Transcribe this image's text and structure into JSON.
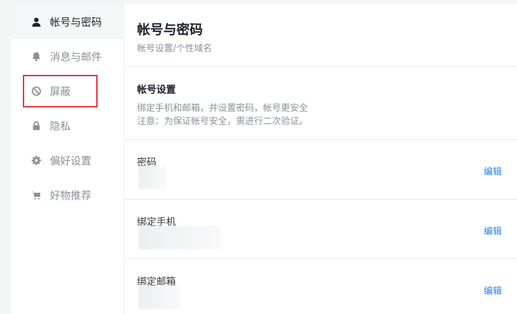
{
  "sidebar": {
    "items": [
      {
        "label": "帐号与密码",
        "icon": "user-icon",
        "active": true
      },
      {
        "label": "消息与邮件",
        "icon": "bell-icon",
        "active": false
      },
      {
        "label": "屏蔽",
        "icon": "block-icon",
        "active": false
      },
      {
        "label": "隐私",
        "icon": "lock-icon",
        "active": false
      },
      {
        "label": "偏好设置",
        "icon": "gear-icon",
        "active": false
      },
      {
        "label": "好物推荐",
        "icon": "cart-icon",
        "active": false
      }
    ]
  },
  "main": {
    "title": "帐号与密码",
    "subtitle": "帐号设置/个性域名",
    "account": {
      "title": "帐号设置",
      "desc1": "绑定手机和邮箱，并设置密码，帐号更安全",
      "desc2": "注意：为保证帐号安全，需进行二次验证。"
    },
    "rows": [
      {
        "label": "密码",
        "action": "编辑"
      },
      {
        "label": "绑定手机",
        "action": "编辑"
      },
      {
        "label": "绑定邮箱",
        "action": "编辑"
      }
    ]
  },
  "colors": {
    "accent": "#1e80ff",
    "highlight": "#e5333a"
  }
}
